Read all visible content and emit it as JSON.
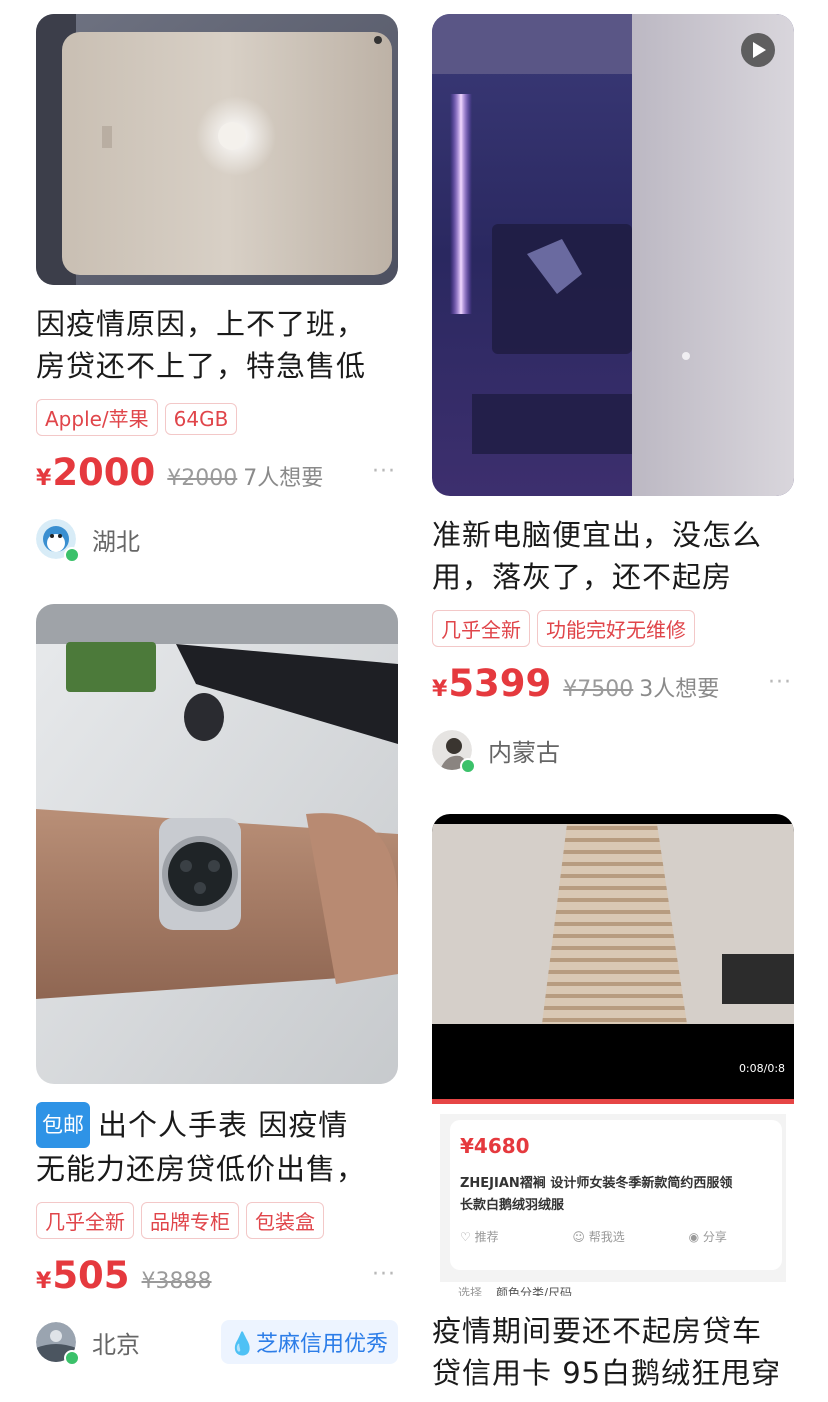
{
  "colors": {
    "price_red": "#e5393e",
    "tag_red": "#e0454a",
    "online_green": "#3bc16a",
    "credit_blue": "#2c7de8",
    "shipping_blue": "#2e93e6"
  },
  "items": [
    {
      "image_desc": "ipad-photo",
      "title_lines": [
        "因疫情原因，上不了班，",
        "房贷还不上了，特急售低"
      ],
      "tags": [
        "Apple/苹果",
        "64GB"
      ],
      "currency": "¥",
      "price": "2000",
      "original_price": "¥2000",
      "wants": "7人想要",
      "more": "···",
      "location": "湖北"
    },
    {
      "image_desc": "computer-case-photo",
      "title_lines": [
        "准新电脑便宜出，没怎么",
        "用，落灰了，还不起房"
      ],
      "tags": [
        "几乎全新",
        "功能完好无维修"
      ],
      "currency": "¥",
      "price": "5399",
      "original_price": "¥7500",
      "wants": "3人想要",
      "more": "···",
      "location": "内蒙古"
    },
    {
      "image_desc": "wristwatch-photo",
      "badge": "包邮",
      "title_lines": [
        "出个人手表  因疫情",
        "无能力还房贷低价出售，"
      ],
      "tags": [
        "几乎全新",
        "品牌专柜",
        "包装盒"
      ],
      "currency": "¥",
      "price": "505",
      "original_price": "¥3888",
      "more": "···",
      "location": "北京",
      "credit": "芝麻信用优秀"
    },
    {
      "image_desc": "down-coat-screenshot",
      "inner": {
        "price": "¥4680",
        "product_line1": "ZHEJIAN褶裥 设计师女装冬季新款简约西服领",
        "product_line2": "长款白鹅绒羽绒服",
        "actions": [
          "推荐",
          "帮我选",
          "分享"
        ],
        "select_label": "选择",
        "select_value": "颜色分类/尺码",
        "video_time": "0:08/0:8"
      },
      "title_lines": [
        "疫情期间要还不起房贷车",
        "贷信用卡 95白鹅绒狂甩穿"
      ]
    }
  ]
}
